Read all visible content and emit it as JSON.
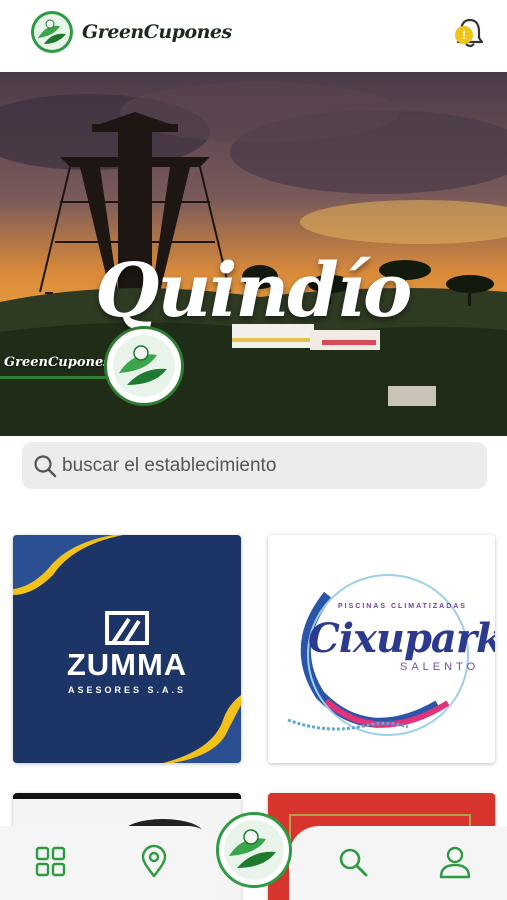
{
  "header": {
    "brand": "GreenCupones",
    "notification_badge": "!"
  },
  "hero": {
    "title": "Quindío",
    "brand": "GreenCupones"
  },
  "search": {
    "placeholder": "buscar el establecimiento"
  },
  "establishments": [
    {
      "name": "ZUMMA",
      "subtitle": "ASESORES S.A.S"
    },
    {
      "name": "Cixupark",
      "top": "PISCINAS CLIMATIZADAS",
      "subtitle": "SALENTO"
    },
    {
      "name": ""
    },
    {
      "name": ""
    }
  ],
  "bottom_nav": {
    "items": [
      "grid-icon",
      "location-pin-icon",
      "home-logo",
      "search-icon",
      "user-icon"
    ]
  },
  "colors": {
    "accent_green": "#2e9a41",
    "dark_green": "#2f7d32",
    "badge_yellow": "#f0c419"
  }
}
